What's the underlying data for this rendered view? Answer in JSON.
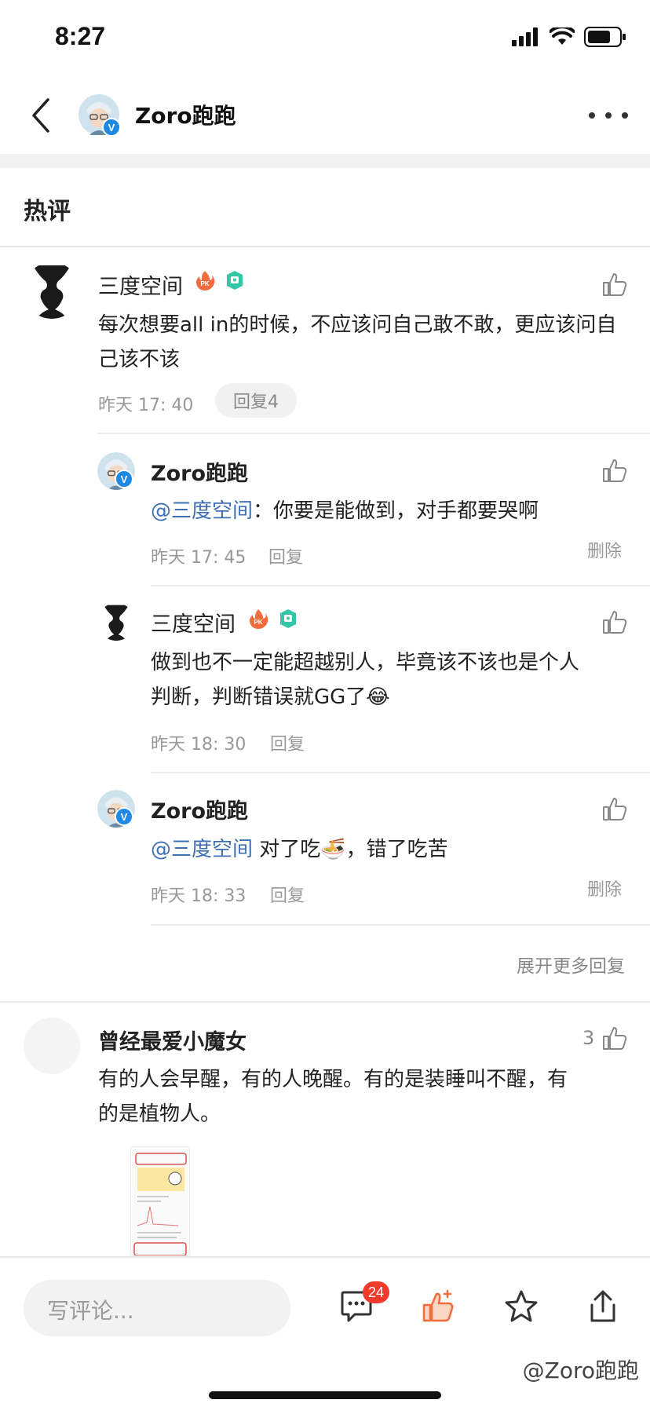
{
  "status_bar": {
    "time": "8:27"
  },
  "header": {
    "title": "Zoro跑跑"
  },
  "section": {
    "title": "热评"
  },
  "comments": [
    {
      "user": "三度空间",
      "text": "每次想要all in的时候，不应该问自己敢不敢，更应该问自己该不该",
      "time": "昨天 17: 40",
      "reply_chip": "回复4",
      "replies": [
        {
          "user": "Zoro跑跑",
          "mention": "@三度空间",
          "text": "：你要是能做到，对手都要哭啊",
          "time": "昨天 17: 45",
          "reply": "回复",
          "delete": "删除"
        },
        {
          "user": "三度空间",
          "text_line1": "做到也不一定能超越别人，毕竟该不该也是个人",
          "text_line2": "判断，判断错误就GG了",
          "emoji": "😂",
          "time": "昨天 18: 30",
          "reply": "回复"
        },
        {
          "user": "Zoro跑跑",
          "mention": "@三度空间",
          "text_a": " 对了吃",
          "emoji": "🍜",
          "text_b": "，错了吃苦",
          "time": "昨天 18: 33",
          "reply": "回复",
          "delete": "删除"
        }
      ],
      "expand_more": "展开更多回复"
    },
    {
      "user": "曾经最爱小魔女",
      "likes": "3",
      "text_line1": "有的人会早醒，有的人晚醒。有的是装睡叫不醒，有",
      "text_line2": "的是植物人。"
    }
  ],
  "bottom_bar": {
    "input_placeholder": "写评论...",
    "comment_count": "24",
    "watermark": "@Zoro跑跑"
  },
  "colors": {
    "accent_like": "#f36c3d",
    "mention": "#3f6fb3",
    "badge": "#f33b2d",
    "verified": "#1e88e5"
  },
  "icons": [
    "signal-icon",
    "wifi-icon",
    "battery-icon",
    "back-icon",
    "more-icon",
    "thumbs-up-icon",
    "pk-fire-icon",
    "vip-badge-icon",
    "comment-bubble-icon",
    "star-icon",
    "share-icon"
  ]
}
